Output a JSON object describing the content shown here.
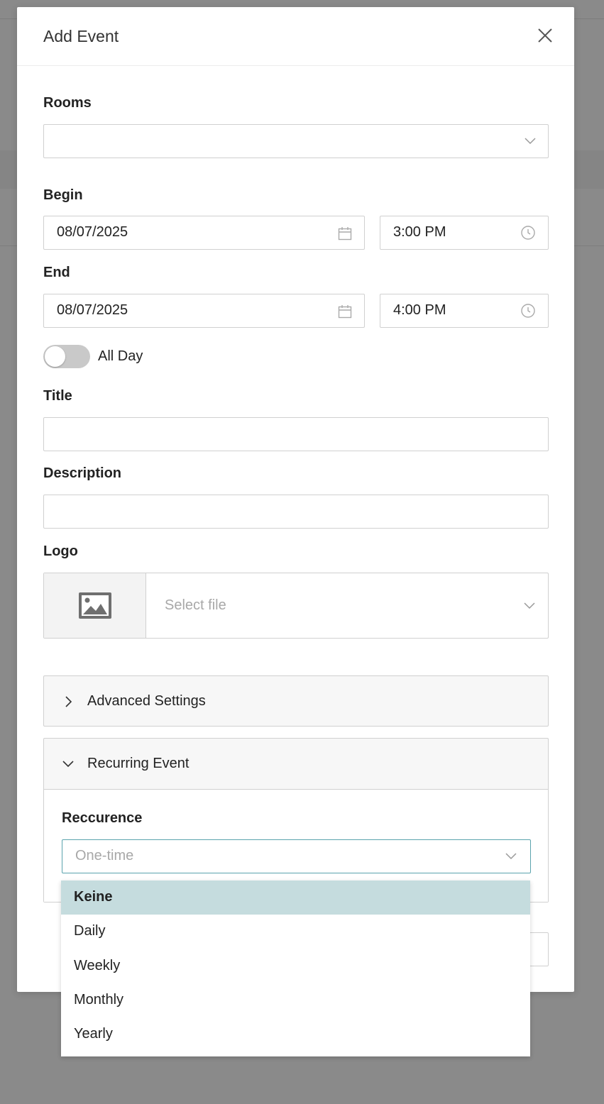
{
  "modal": {
    "title": "Add Event"
  },
  "form": {
    "rooms": {
      "label": "Rooms",
      "value": ""
    },
    "begin": {
      "label": "Begin",
      "date": "08/07/2025",
      "time": "3:00 PM"
    },
    "end": {
      "label": "End",
      "date": "08/07/2025",
      "time": "4:00 PM"
    },
    "all_day": {
      "label": "All Day",
      "checked": false
    },
    "title": {
      "label": "Title",
      "value": ""
    },
    "description": {
      "label": "Description",
      "value": ""
    },
    "logo": {
      "label": "Logo",
      "placeholder": "Select file"
    }
  },
  "advanced": {
    "title": "Advanced Settings",
    "expanded": false
  },
  "recurring": {
    "title": "Recurring Event",
    "expanded": true,
    "recurrence_label": "Reccurence",
    "placeholder": "One-time",
    "accent_color": "#5aa3ad"
  },
  "dropdown": {
    "selected_index": 0,
    "selected_color": "#c5dcde",
    "options": [
      "Keine",
      "Daily",
      "Weekly",
      "Monthly",
      "Yearly"
    ]
  }
}
